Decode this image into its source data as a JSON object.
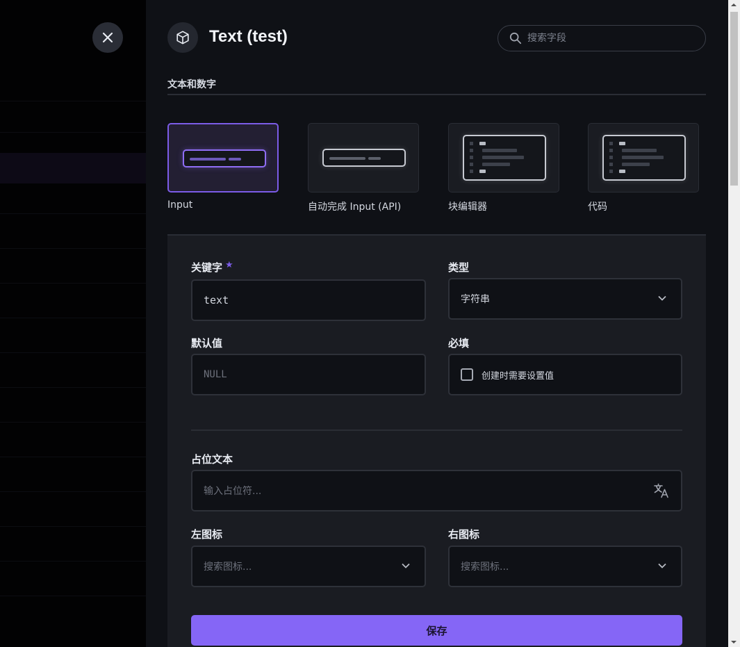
{
  "header": {
    "title": "Text (test)",
    "search_placeholder": "搜索字段",
    "icon": "cube-icon"
  },
  "section": {
    "title": "文本和数字"
  },
  "interfaces": [
    {
      "label": "Input",
      "selected": true
    },
    {
      "label": "自动完成 Input (API)",
      "selected": false
    },
    {
      "label": "块编辑器",
      "selected": false
    },
    {
      "label": "代码",
      "selected": false
    }
  ],
  "form": {
    "key_label": "关键字",
    "key_required_mark": "★",
    "key_value": "text",
    "type_label": "类型",
    "type_value": "字符串",
    "default_label": "默认值",
    "default_placeholder": "NULL",
    "required_label": "必填",
    "required_checkbox_label": "创建时需要设置值",
    "required_checked": false,
    "placeholder_label": "占位文本",
    "placeholder_input_placeholder": "输入占位符...",
    "left_icon_label": "左图标",
    "left_icon_placeholder": "搜索图标...",
    "right_icon_label": "右图标",
    "right_icon_placeholder": "搜索图标...",
    "save_label": "保存"
  },
  "colors": {
    "accent": "#8566f6",
    "drawer_bg": "#0f1116",
    "panel_bg": "#1a1c22"
  }
}
